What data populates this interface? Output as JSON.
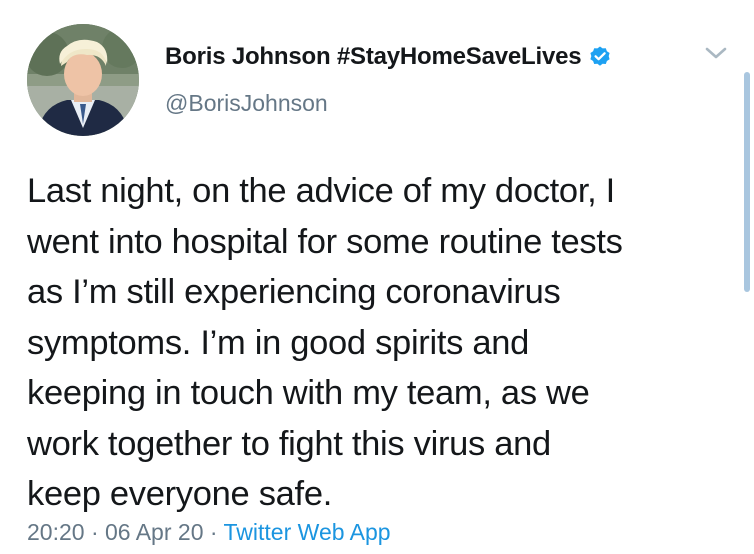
{
  "author": {
    "display_name": "Boris Johnson #StayHomeSaveLives",
    "handle": "@BorisJohnson",
    "verified": true
  },
  "tweet": {
    "lines": [
      "Last night, on the advice of my doctor, I",
      "went into hospital for some routine tests",
      "as I’m still experiencing coronavirus",
      "symptoms. I’m in good spirits and",
      "keeping in touch with my team, as we",
      "work together to fight this virus and",
      "keep everyone safe."
    ]
  },
  "meta": {
    "time": "20:20",
    "separator": "·",
    "date": "06 Apr 20",
    "source": "Twitter Web App"
  },
  "colors": {
    "text": "#14171a",
    "secondary": "#657786",
    "link": "#1b95e0",
    "verified_badge": "#1da1f2"
  },
  "icons": {
    "verified": "verified-badge-icon",
    "menu": "chevron-down-icon"
  }
}
